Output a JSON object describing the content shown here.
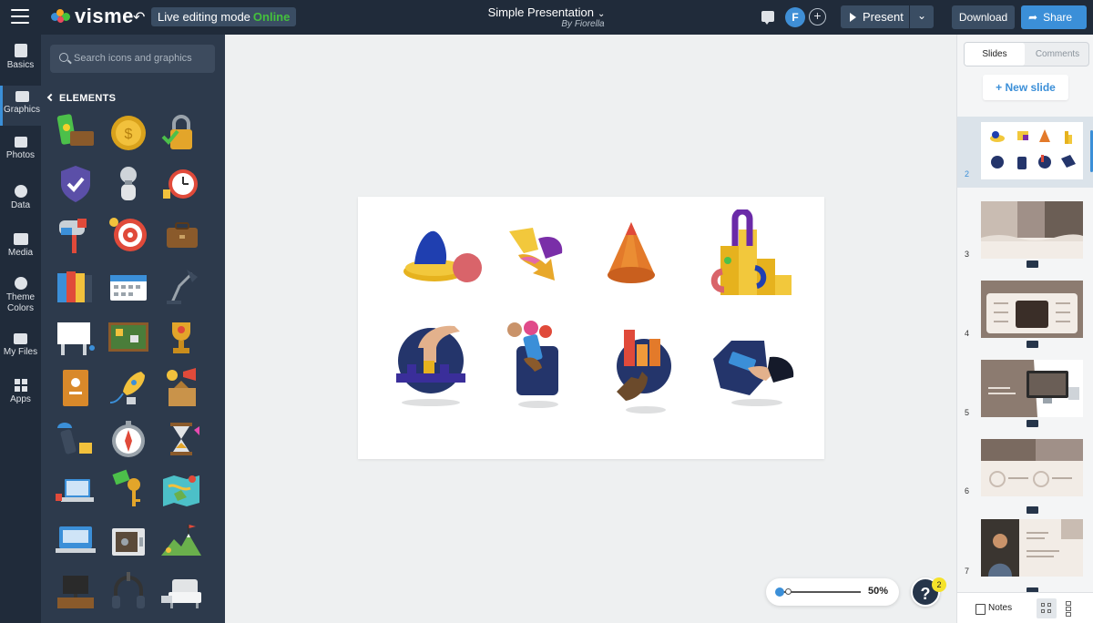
{
  "topbar": {
    "brand": "visme",
    "live_label": "Live editing mode",
    "live_status": "Online",
    "doc_title": "Simple Presentation",
    "doc_author": "By Fiorella",
    "avatar_initial": "F",
    "present_label": "Present",
    "download_label": "Download",
    "share_label": "Share"
  },
  "rail": [
    {
      "label": "Basics",
      "icon": "basics-icon"
    },
    {
      "label": "Graphics",
      "icon": "graphics-icon",
      "active": true
    },
    {
      "label": "Photos",
      "icon": "photos-icon"
    },
    {
      "label": "Data",
      "icon": "data-icon"
    },
    {
      "label": "Media",
      "icon": "media-icon"
    },
    {
      "label": "Theme\nColors",
      "icon": "theme-colors-icon"
    },
    {
      "label": "My Files",
      "icon": "my-files-icon"
    },
    {
      "label": "Apps",
      "icon": "apps-icon"
    }
  ],
  "panel": {
    "search_placeholder": "Search icons and graphics",
    "section_title": "ELEMENTS",
    "elements": [
      "phone-money-graphic",
      "coin-graphic",
      "padlock-graphic",
      "shield-check-graphic",
      "lightbulb-head-graphic",
      "alarm-clock-graphic",
      "mailbox-graphic",
      "target-graphic",
      "briefcase-graphic",
      "binders-graphic",
      "calendar-graphic",
      "desk-lamp-graphic",
      "whiteboard-graphic",
      "corkboard-graphic",
      "trophy-graphic",
      "notebook-graphic",
      "rocket-graphic",
      "megaphone-box-graphic",
      "usb-drive-graphic",
      "compass-graphic",
      "hourglass-graphic",
      "laptop-graphic",
      "key-tag-graphic",
      "map-graphic",
      "laptop-screen-graphic",
      "safe-graphic",
      "mountain-flag-graphic",
      "tv-stand-graphic",
      "headphones-graphic",
      "armchair-graphic"
    ]
  },
  "canvas": {
    "zoom_value": "50%",
    "help_label": "?",
    "help_badge": "2"
  },
  "slides_panel": {
    "tab_slides": "Slides",
    "tab_comments": "Comments",
    "new_slide": "+ New slide",
    "thumbnails": [
      {
        "number": "2",
        "active": true
      },
      {
        "number": "3"
      },
      {
        "number": "4"
      },
      {
        "number": "5"
      },
      {
        "number": "6"
      },
      {
        "number": "7"
      }
    ],
    "notes_label": "Notes"
  },
  "colors": {
    "topbar": "#202b3a",
    "panel": "#2d3a4c",
    "accent": "#3b8fd8",
    "online": "#44c13c"
  }
}
